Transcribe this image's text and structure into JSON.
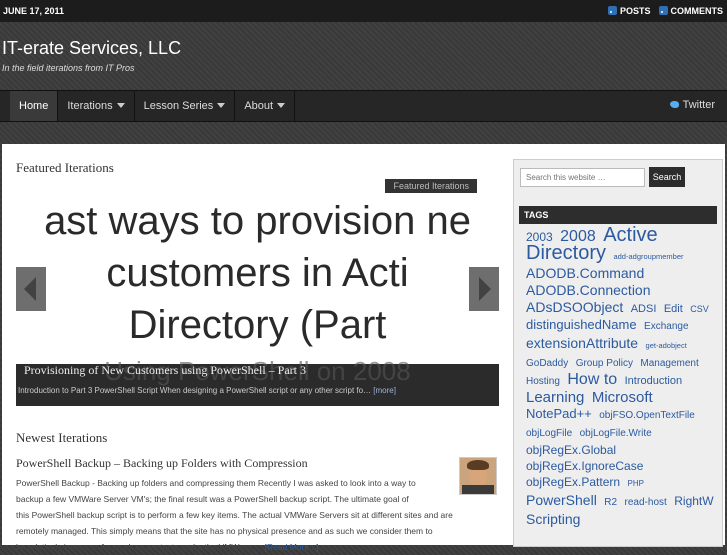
{
  "topbar": {
    "date": "JUNE 17, 2011",
    "posts_label": "POSTS",
    "comments_label": "COMMENTS",
    "icon": "rss-icon"
  },
  "header": {
    "site_title": "IT-erate Services, LLC",
    "tagline": "In the field iterations from IT Pros"
  },
  "nav": {
    "items": [
      {
        "label": "Home"
      },
      {
        "label": "Iterations"
      },
      {
        "label": "Lesson Series"
      },
      {
        "label": "About"
      }
    ],
    "twitter_label": "Twitter"
  },
  "featured": {
    "heading": "Featured Iterations",
    "slide_tag": "Featured Iterations",
    "slide_lines": [
      "ast ways to provision ne",
      "customers in Acti",
      "Directory (Part",
      "Using PowerShell on 2008"
    ],
    "caption_title": "Provisioning of New Customers using PowerShell – Part 3",
    "caption_excerpt": "Introduction to Part 3 PowerShell Script When designing a PowerShell script or any other script fo…",
    "caption_more": "[more]"
  },
  "newest": {
    "heading": "Newest Iterations",
    "post_title": "PowerShell Backup – Backing up Folders with Compression",
    "post_lines": [
      "PowerShell Backup - Backing up folders and compressing them Recently I was asked to look into a way to",
      "backup a few VMWare Server VM's; the final result was a PowerShell backup script. The ultimate goal of",
      "this PowerShell backup script is to perform a few key items. The actual VMWare Servers sit at different sites and are",
      "remotely managed. This simply means that the site has no physical presence and as such we consider them to",
      "be relatively insecure. As much as we try to make the VMWare …"
    ],
    "read_more": "[Read More...]"
  },
  "sidebar": {
    "search_placeholder": "Search this website …",
    "search_button": "Search",
    "tags_heading": "TAGS",
    "tags": [
      {
        "text": "2003",
        "size": 12
      },
      {
        "text": "2008",
        "size": 16
      },
      {
        "text": "Active Directory",
        "size": 20
      },
      {
        "text": "add-adgroupmember",
        "size": 7.5
      },
      {
        "text": "ADODB.Command",
        "size": 14
      },
      {
        "text": "ADODB.Connection",
        "size": 14
      },
      {
        "text": "ADsDSOObject",
        "size": 14
      },
      {
        "text": "ADSI",
        "size": 11
      },
      {
        "text": "Edit",
        "size": 11
      },
      {
        "text": "CSV",
        "size": 9
      },
      {
        "text": "distinguishedName",
        "size": 13
      },
      {
        "text": "Exchange",
        "size": 10
      },
      {
        "text": "extensionAttribute",
        "size": 14
      },
      {
        "text": "get-adobject",
        "size": 7.5
      },
      {
        "text": "GoDaddy",
        "size": 10
      },
      {
        "text": "Group Policy",
        "size": 10
      },
      {
        "text": "Management",
        "size": 10
      },
      {
        "text": "Hosting",
        "size": 10
      },
      {
        "text": "How to",
        "size": 16
      },
      {
        "text": "Introduction",
        "size": 11
      },
      {
        "text": "Learning",
        "size": 15
      },
      {
        "text": "Microsoft",
        "size": 15
      },
      {
        "text": "NotePad++",
        "size": 13
      },
      {
        "text": "objFSO.OpenTextFile",
        "size": 10
      },
      {
        "text": "objLogFile",
        "size": 10
      },
      {
        "text": "objLogFile.Write",
        "size": 10
      },
      {
        "text": "objRegEx.Global",
        "size": 12
      },
      {
        "text": "objRegEx.IgnoreCase",
        "size": 12
      },
      {
        "text": "objRegEx.Pattern",
        "size": 12
      },
      {
        "text": "PHP",
        "size": 8
      },
      {
        "text": "PowerShell",
        "size": 14
      },
      {
        "text": "R2",
        "size": 10
      },
      {
        "text": "read-host",
        "size": 10
      },
      {
        "text": "RightW",
        "size": 12
      },
      {
        "text": "Scripting",
        "size": 14
      }
    ]
  }
}
